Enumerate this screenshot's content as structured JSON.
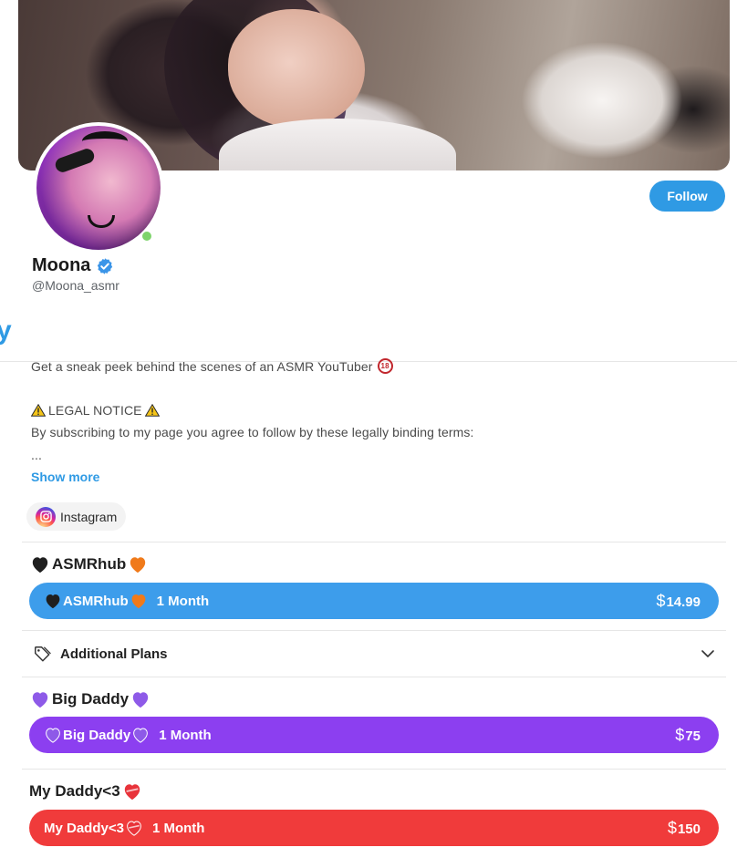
{
  "profile": {
    "display_name": "Moona",
    "handle": "@Moona_asmr",
    "online": true,
    "verified": true
  },
  "header": {
    "follow_label": "Follow",
    "edge_glyph": "y"
  },
  "bio": {
    "line1": "Get a sneak peek behind the scenes of an ASMR YouTuber",
    "age_badge": "18",
    "legal_notice": "LEGAL NOTICE",
    "line3": "By subscribing to my page you agree to follow by these legally binding terms:",
    "ellipsis": "...",
    "show_more": "Show more"
  },
  "links": {
    "instagram_label": "Instagram"
  },
  "plans": [
    {
      "section_title": "ASMRhub",
      "name": "ASMRhub",
      "period": "1 Month",
      "currency": "$",
      "price": "14.99",
      "color": "#3d9deb",
      "heart_left": "#1f1f1f",
      "heart_right": "#f07a1a"
    },
    {
      "section_title": "Big Daddy",
      "name": "Big Daddy",
      "period": "1 Month",
      "currency": "$",
      "price": "75",
      "color": "#8c3ff0",
      "heart_left": "#8e5ae8",
      "heart_right": "#8e5ae8"
    },
    {
      "section_title": "My Daddy<3",
      "name": "My Daddy<3",
      "period": "1 Month",
      "currency": "$",
      "price": "150",
      "color": "#f03b3b",
      "heart_right": "#e8333a"
    }
  ],
  "additional_plans": {
    "label": "Additional Plans",
    "icon": "tag-icon"
  },
  "colors": {
    "accent": "#2f9ae4",
    "online": "#7ed36b"
  }
}
